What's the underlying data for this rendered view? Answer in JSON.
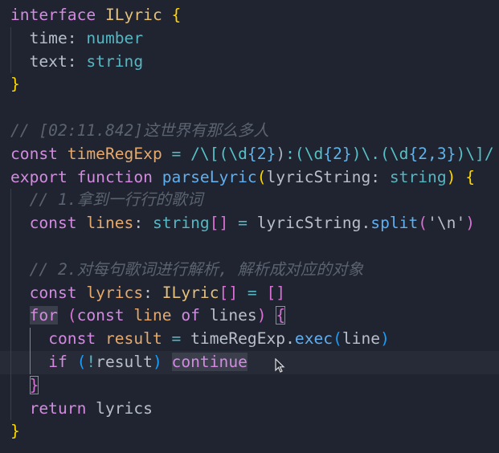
{
  "lines": [
    [
      [
        "interface",
        "kw"
      ],
      [
        " ",
        ""
      ],
      [
        "ILyric",
        "ty"
      ],
      [
        " ",
        ""
      ],
      [
        "{",
        "br1"
      ]
    ],
    [
      [
        "  ",
        ""
      ],
      [
        "time",
        "prop"
      ],
      [
        ": ",
        "prop"
      ],
      [
        "number",
        "tp"
      ]
    ],
    [
      [
        "  ",
        ""
      ],
      [
        "text",
        "prop"
      ],
      [
        ": ",
        "prop"
      ],
      [
        "string",
        "tp"
      ]
    ],
    [
      [
        "}",
        "br1"
      ]
    ],
    [],
    [
      [
        "// [02:11.842]这世界有那么多人",
        "cm"
      ]
    ],
    [
      [
        "const",
        "kw"
      ],
      [
        " ",
        ""
      ],
      [
        "timeRegExp",
        "var"
      ],
      [
        " ",
        ""
      ],
      [
        "=",
        "op"
      ],
      [
        " ",
        ""
      ],
      [
        "/\\[(\\d",
        "re"
      ],
      [
        "{2}",
        "re2"
      ],
      [
        ")",
        ""
      ],
      [
        ":(\\d",
        "re"
      ],
      [
        "{2}",
        "re2"
      ],
      [
        ")\\.(\\d",
        "re"
      ],
      [
        "{2,3}",
        "re2"
      ],
      [
        ")\\]/",
        "re"
      ]
    ],
    [
      [
        "export",
        "kw"
      ],
      [
        " ",
        ""
      ],
      [
        "function",
        "kw"
      ],
      [
        " ",
        ""
      ],
      [
        "parseLyric",
        "fn"
      ],
      [
        "(",
        "br1"
      ],
      [
        "lyricString",
        "prop"
      ],
      [
        ": ",
        "prop"
      ],
      [
        "string",
        "tp"
      ],
      [
        ")",
        "br1"
      ],
      [
        " ",
        ""
      ],
      [
        "{",
        "br1"
      ]
    ],
    [
      [
        "  ",
        ""
      ],
      [
        "// 1.拿到一行行的歌词",
        "cm"
      ]
    ],
    [
      [
        "  ",
        ""
      ],
      [
        "const",
        "kw"
      ],
      [
        " ",
        ""
      ],
      [
        "lines",
        "var"
      ],
      [
        ": ",
        "prop"
      ],
      [
        "string",
        "tp"
      ],
      [
        "[]",
        "br2"
      ],
      [
        " ",
        ""
      ],
      [
        "=",
        "op"
      ],
      [
        " ",
        ""
      ],
      [
        "lyricString",
        "prop"
      ],
      [
        ".",
        "prop"
      ],
      [
        "split",
        "fn"
      ],
      [
        "(",
        "br2"
      ],
      [
        "'\\n'",
        "prop"
      ],
      [
        ")",
        "br2"
      ]
    ],
    [],
    [
      [
        "  ",
        ""
      ],
      [
        "// 2.对每句歌词进行解析, 解析成对应的对象",
        "cm"
      ]
    ],
    [
      [
        "  ",
        ""
      ],
      [
        "const",
        "kw"
      ],
      [
        " ",
        ""
      ],
      [
        "lyrics",
        "var"
      ],
      [
        ": ",
        "prop"
      ],
      [
        "ILyric",
        "ty"
      ],
      [
        "[]",
        "br2"
      ],
      [
        " ",
        ""
      ],
      [
        "=",
        "op"
      ],
      [
        " ",
        ""
      ],
      [
        "[]",
        "br2"
      ]
    ],
    [
      [
        "  ",
        ""
      ],
      [
        "for",
        "kw sel"
      ],
      [
        " ",
        ""
      ],
      [
        "(",
        "br2"
      ],
      [
        "const",
        "kw"
      ],
      [
        " ",
        ""
      ],
      [
        "line",
        "var"
      ],
      [
        " ",
        ""
      ],
      [
        "of",
        "kw"
      ],
      [
        " ",
        ""
      ],
      [
        "lines",
        "prop"
      ],
      [
        ")",
        "br2"
      ],
      [
        " ",
        ""
      ],
      [
        "{",
        "br2 match"
      ]
    ],
    [
      [
        "    ",
        ""
      ],
      [
        "const",
        "kw"
      ],
      [
        " ",
        ""
      ],
      [
        "result",
        "var"
      ],
      [
        " ",
        ""
      ],
      [
        "=",
        "op"
      ],
      [
        " ",
        ""
      ],
      [
        "timeRegExp",
        "prop"
      ],
      [
        ".",
        "prop"
      ],
      [
        "exec",
        "fn"
      ],
      [
        "(",
        "br3"
      ],
      [
        "line",
        "prop"
      ],
      [
        ")",
        "br3"
      ]
    ],
    [
      [
        "    ",
        ""
      ],
      [
        "if",
        "kw"
      ],
      [
        " ",
        ""
      ],
      [
        "(",
        "br3"
      ],
      [
        "!",
        "op"
      ],
      [
        "result",
        "prop"
      ],
      [
        ")",
        "br3"
      ],
      [
        " ",
        ""
      ],
      [
        "continue",
        "kw sel"
      ]
    ],
    [
      [
        "  ",
        ""
      ],
      [
        "}",
        "br2 match"
      ]
    ],
    [
      [
        "  ",
        ""
      ],
      [
        "return",
        "kw"
      ],
      [
        " ",
        ""
      ],
      [
        "lyrics",
        "prop"
      ]
    ],
    [
      [
        "}",
        "br1"
      ]
    ]
  ],
  "current_line": 15
}
